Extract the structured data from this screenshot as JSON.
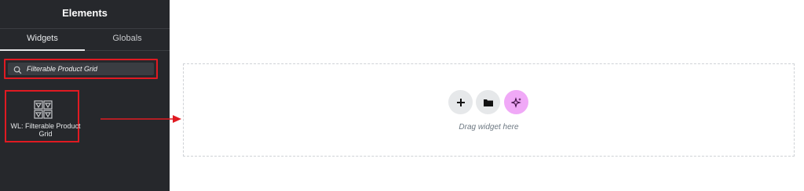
{
  "panel": {
    "title": "Elements",
    "tabs": [
      {
        "label": "Widgets",
        "active": true
      },
      {
        "label": "Globals",
        "active": false
      }
    ],
    "search": {
      "value": "Filterable Product Grid"
    },
    "widgets": [
      {
        "label": "WL: Filterable Product Grid",
        "icon": "grid-widget-icon"
      }
    ]
  },
  "canvas": {
    "drop_text": "Drag widget here",
    "buttons": [
      {
        "icon": "plus-icon",
        "action": "add-section"
      },
      {
        "icon": "folder-icon",
        "action": "add-template"
      },
      {
        "icon": "ai-sparkle-icon",
        "action": "ai-generate"
      }
    ]
  },
  "colors": {
    "panel_bg": "#26282c",
    "highlight": "#e01a22",
    "ai_button": "#f0a9f7",
    "control_button": "#e6e8ea"
  }
}
